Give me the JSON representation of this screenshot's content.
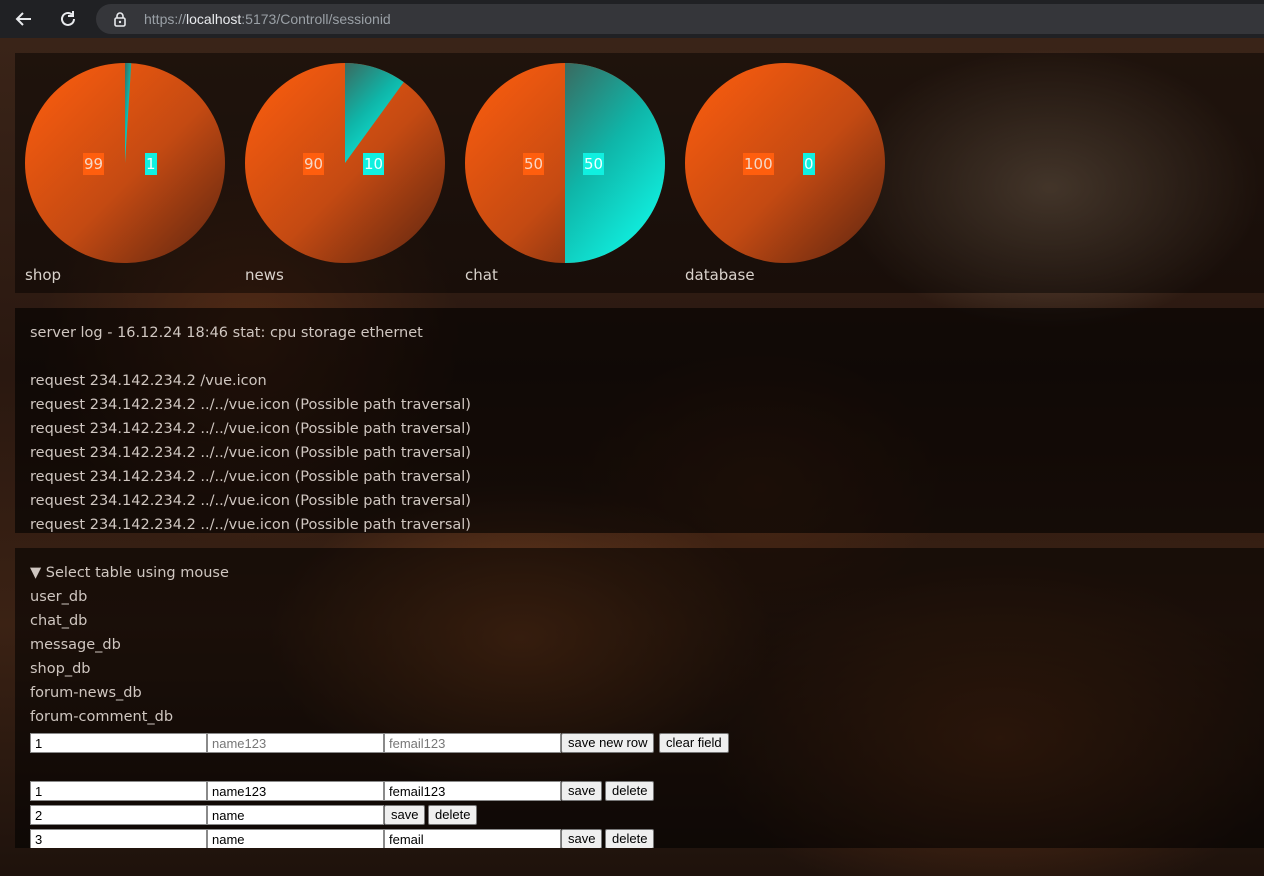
{
  "browser": {
    "url_scheme": "https://",
    "url_host": "localhost",
    "url_rest": ":5173/Controll/sessionid"
  },
  "charts": [
    {
      "label": "shop",
      "a": 99,
      "b": 1
    },
    {
      "label": "news",
      "a": 90,
      "b": 10
    },
    {
      "label": "chat",
      "a": 50,
      "b": 50
    },
    {
      "label": "database",
      "a": 100,
      "b": 0
    }
  ],
  "chart_data": {
    "type": "pie",
    "series": [
      {
        "name": "shop",
        "values": [
          99,
          1
        ]
      },
      {
        "name": "news",
        "values": [
          90,
          10
        ]
      },
      {
        "name": "chat",
        "values": [
          50,
          50
        ]
      },
      {
        "name": "database",
        "values": [
          100,
          0
        ]
      }
    ],
    "colors": [
      "#ff5e0e",
      "#10f0e0"
    ]
  },
  "log": {
    "header": "server log - 16.12.24 18:46 stat: cpu storage ethernet",
    "lines": [
      "request 234.142.234.2 /vue.icon",
      "request 234.142.234.2 ../../vue.icon (Possible path traversal)",
      "request 234.142.234.2 ../../vue.icon (Possible path traversal)",
      "request 234.142.234.2 ../../vue.icon (Possible path traversal)",
      "request 234.142.234.2 ../../vue.icon (Possible path traversal)",
      "request 234.142.234.2 ../../vue.icon (Possible path traversal)",
      "request 234.142.234.2 ../../vue.icon (Possible path traversal)"
    ]
  },
  "db": {
    "summary": "▼ Select table using mouse",
    "tables": [
      "user_db",
      "chat_db",
      "message_db",
      "shop_db",
      "forum-news_db",
      "forum-comment_db"
    ],
    "new_row": {
      "id": "1",
      "name_placeholder": "name123",
      "email_placeholder": "femail123",
      "save_label": "save new row",
      "clear_label": "clear field"
    },
    "rows": [
      {
        "id": "1",
        "name": "name123",
        "email": "femail123"
      },
      {
        "id": "2",
        "name": "name",
        "email": ""
      },
      {
        "id": "3",
        "name": "name",
        "email": "femail"
      }
    ],
    "save_label": "save",
    "delete_label": "delete"
  }
}
